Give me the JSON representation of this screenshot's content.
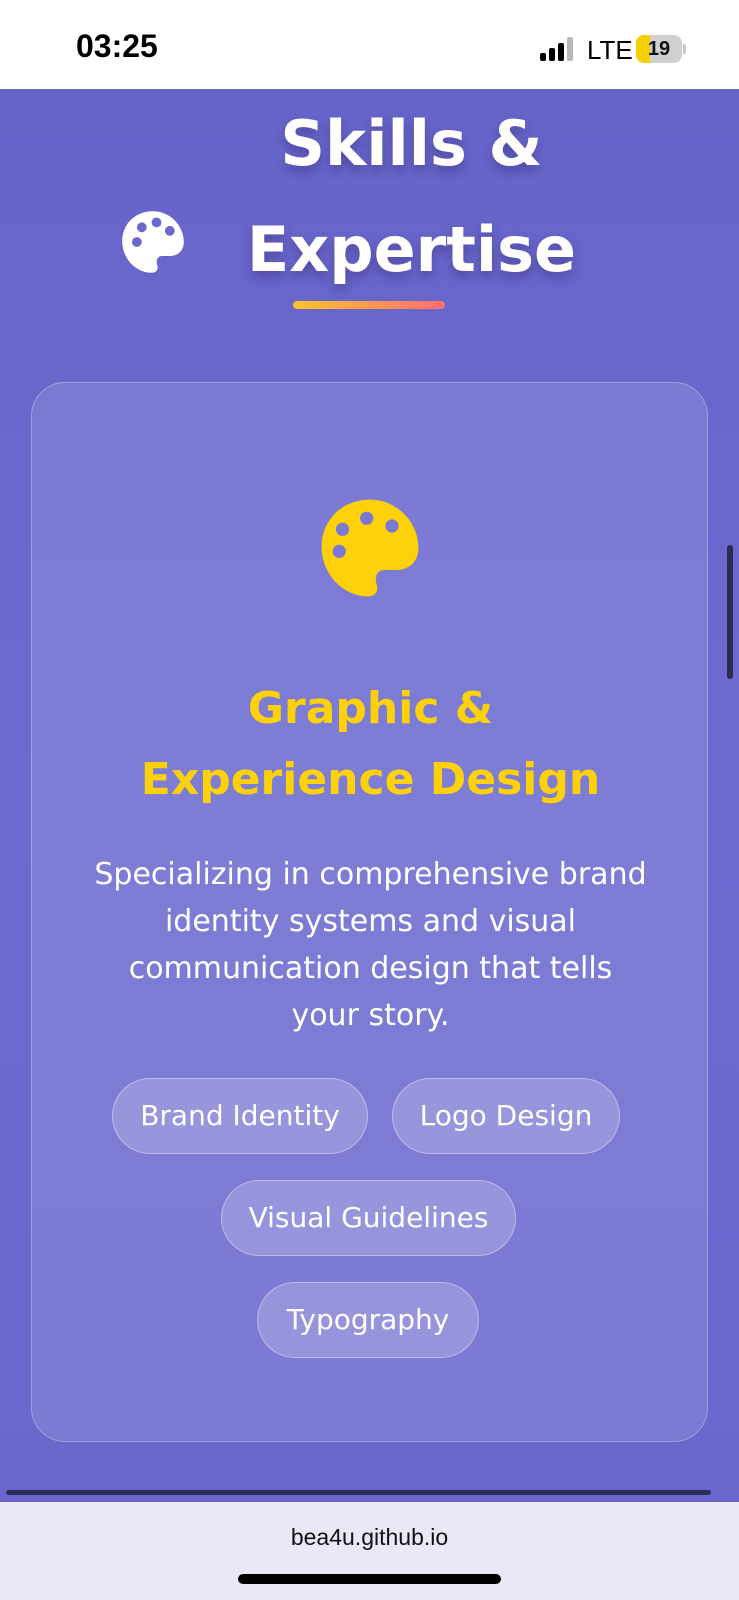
{
  "status_bar": {
    "time": "03:25",
    "network": "LTE",
    "battery_level": "19",
    "battery_fraction": 0.19,
    "signal_bars_active": 3,
    "signal_bars_total": 4
  },
  "section": {
    "title": "Skills & Expertise",
    "title_icon": "palette-icon",
    "underline_colors": [
      "#f7c52b",
      "#ff6f6f"
    ]
  },
  "card": {
    "icon": "palette-icon",
    "icon_color": "#fcd10a",
    "title": "Graphic & Experience Design",
    "description": "Specializing in comprehensive brand identity systems and visual communication design that tells your story.",
    "tags": [
      "Brand Identity",
      "Logo Design",
      "Visual Guidelines",
      "Typography"
    ]
  },
  "browser": {
    "url": "bea4u.github.io"
  },
  "colors": {
    "background": "#6a68cc",
    "accent": "#fcd10a"
  }
}
